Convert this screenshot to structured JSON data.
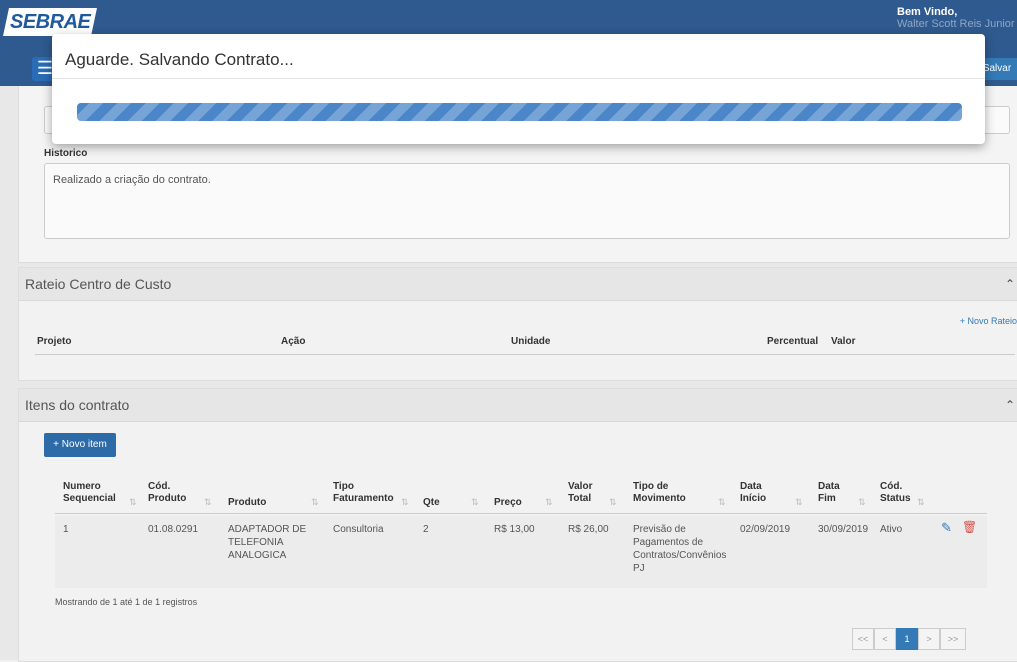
{
  "header": {
    "logo": "SEBRAE",
    "welcome": "Bem Vindo,",
    "user_name": "Walter Scott Reis Junior",
    "save_label": "Salvar"
  },
  "modal": {
    "title": "Aguarde. Salvando Contrato...",
    "progress_fraction": 1.0
  },
  "historico": {
    "label": "Historico",
    "value": "Realizado a criação do contrato."
  },
  "rateio": {
    "title": "Rateio Centro de Custo",
    "new_label": "+ Novo Rateio",
    "columns": [
      "Projeto",
      "Ação",
      "Unidade",
      "Percentual",
      "Valor"
    ]
  },
  "itens": {
    "title": "Itens do contrato",
    "new_label": "+ Novo item",
    "columns": [
      "Numero Sequencial",
      "Cód. Produto",
      "Produto",
      "Tipo Faturamento",
      "Qte",
      "Preço",
      "Valor Total",
      "Tipo de Movimento",
      "Data Início",
      "Data Fim",
      "Cód. Status"
    ],
    "rows": [
      {
        "seq": "1",
        "cod_produto": "01.08.0291",
        "produto": "ADAPTADOR DE TELEFONIA ANALOGICA",
        "tipo_faturamento": "Consultoria",
        "qte": "2",
        "preco": "R$ 13,00",
        "valor_total": "R$ 26,00",
        "tipo_movimento": "Previsão de Pagamentos de Contratos/Convênios PJ",
        "data_inicio": "02/09/2019",
        "data_fim": "30/09/2019",
        "status": "Ativo"
      }
    ],
    "footer": "Mostrando de 1 até 1 de 1 registros",
    "pagination": [
      "<<",
      "<",
      "1",
      ">",
      ">>"
    ]
  },
  "colors": {
    "header_bg": "#2f5a8f",
    "primary": "#337ab7",
    "delete": "#d9534f"
  }
}
